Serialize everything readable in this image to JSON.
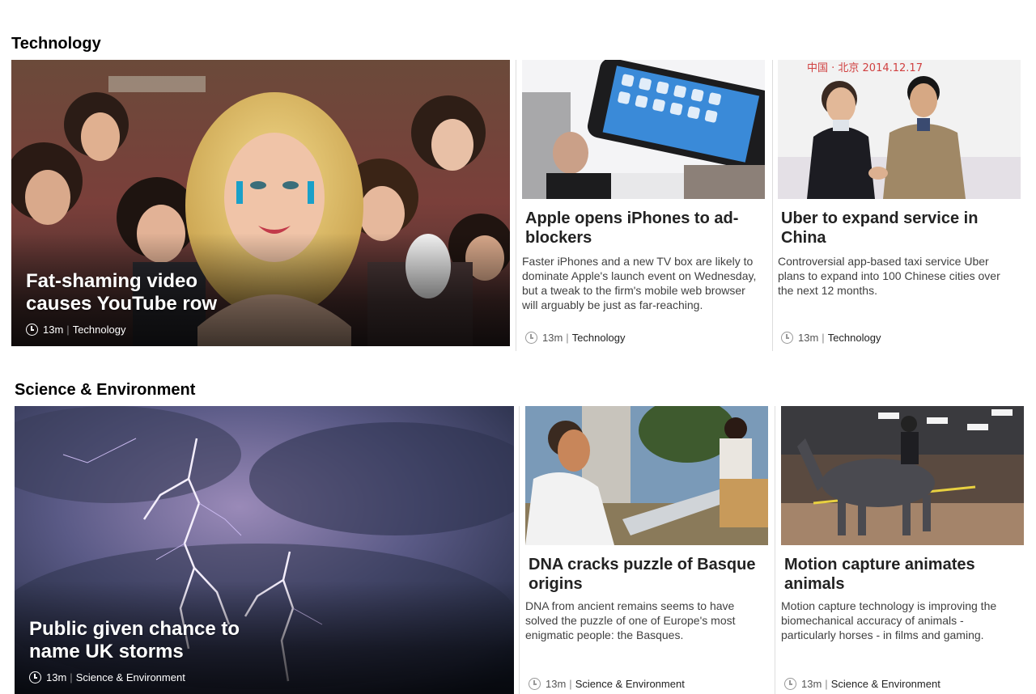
{
  "sections": [
    {
      "title": "Technology",
      "hero": {
        "headline": "Fat-shaming video causes YouTube row",
        "time": "13m",
        "category": "Technology",
        "image": "crowd-photo"
      },
      "cards": [
        {
          "headline": "Apple opens iPhones to ad-blockers",
          "summary": "Faster iPhones and a new TV box are likely to dominate Apple's launch event on Wednesday, but a tweak to the firm's mobile web browser will arguably be just as far-reaching.",
          "time": "13m",
          "category": "Technology",
          "image": "iphone-photo"
        },
        {
          "headline": "Uber to expand service in China",
          "summary": "Controversial app-based taxi service Uber plans to expand into 100 Chinese cities over the next 12 months.",
          "time": "13m",
          "category": "Technology",
          "image": "handshake-photo",
          "image_caption": "中国 · 北京  2014.12.17"
        }
      ]
    },
    {
      "title": "Science & Environment",
      "hero": {
        "headline": "Public given chance to name UK storms",
        "time": "13m",
        "category": "Science & Environment",
        "image": "lightning-photo"
      },
      "cards": [
        {
          "headline": "DNA cracks puzzle of Basque origins",
          "summary": "DNA from ancient remains seems to have solved the puzzle of one of Europe's most enigmatic people: the Basques.",
          "time": "13m",
          "category": "Science & Environment",
          "image": "saw-photo"
        },
        {
          "headline": "Motion capture animates animals",
          "summary": "Motion capture technology is improving the biomechanical accuracy of animals - particularly horses - in films and gaming.",
          "time": "13m",
          "category": "Science & Environment",
          "image": "horse-photo"
        }
      ]
    }
  ],
  "meta_separator": "|"
}
